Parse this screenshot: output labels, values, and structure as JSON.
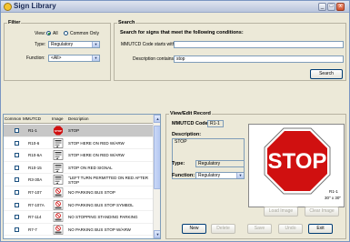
{
  "window": {
    "title": "Sign Library",
    "minimize": "_",
    "maximize": "□",
    "close": "x"
  },
  "filter": {
    "group_label": "Filter",
    "view_label": "View:",
    "view_all": "All",
    "view_common": "Common Only",
    "type_label": "Type:",
    "type_value": "Regulatory",
    "function_label": "Function:",
    "function_value": "<All>"
  },
  "search": {
    "group_label": "Search",
    "heading": "Search for signs that meet the following conditions:",
    "code_label": "MMUTCD Code starts with:",
    "code_value": "",
    "desc_label": "Description contains:",
    "desc_value": "stop",
    "button": "Search"
  },
  "list": {
    "columns": [
      "Common",
      "MMUTCD",
      "Image",
      "Description"
    ],
    "rows": [
      {
        "code": "R1-1",
        "desc": "STOP",
        "img": "stop",
        "selected": true
      },
      {
        "code": "R10-6",
        "desc": "STOP HERE ON RED W/ARW",
        "img": "sign"
      },
      {
        "code": "R10-6A",
        "desc": "STOP HERE ON RED W/ARW",
        "img": "sign"
      },
      {
        "code": "R10-15",
        "desc": "STOP ON RED SIGNAL",
        "img": "sign"
      },
      {
        "code": "R3-30A",
        "desc": "\"LEFT TURN PERMITTED ON RED AFTER STOP",
        "img": "sign"
      },
      {
        "code": "R7-107",
        "desc": "NO PARKING BUS STOP",
        "img": "bus"
      },
      {
        "code": "R7-107A",
        "desc": "NO PARKING BUS STOP SYMBOL",
        "img": "bus"
      },
      {
        "code": "R7-114",
        "desc": "NO STOPPING STANDING PARKING",
        "img": "bus"
      },
      {
        "code": "R7-7",
        "desc": "NO PARKING BUS STOP W/ARW",
        "img": "bus"
      }
    ]
  },
  "record": {
    "group_label": "View/Edit Record",
    "code_label": "MMUTCD Code:",
    "code_value": "R1-1",
    "desc_label": "Description:",
    "desc_value": "STOP",
    "type_label": "Type:",
    "type_value": "Regulatory",
    "function_label": "Function:",
    "function_value": "Regulatory",
    "preview_sign_text": "STOP",
    "preview_code": "R1-1",
    "preview_size": "30\" x 30\"",
    "load_image": "Load Image",
    "clear_image": "Clear Image",
    "new": "New",
    "delete": "Delete",
    "save": "Save",
    "undo": "Undo",
    "exit": "Exit"
  },
  "colors": {
    "stop_red": "#d01010",
    "selection": "#c7c7c7"
  }
}
